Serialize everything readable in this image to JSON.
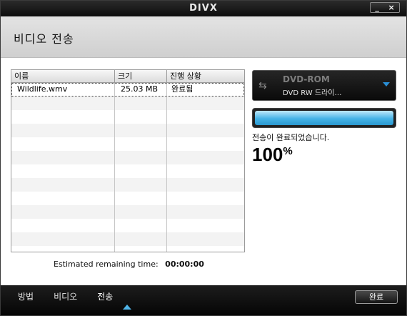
{
  "window": {
    "logo": "DIVX",
    "minimize": "_",
    "close": "×"
  },
  "header": {
    "title": "비디오 전송"
  },
  "file_table": {
    "columns": [
      "이름",
      "크기",
      "진행 상황"
    ],
    "rows": [
      {
        "name": "Wildlife.wmv",
        "size": "25.03 MB",
        "status": "완료됨"
      }
    ]
  },
  "remaining": {
    "label": "Estimated remaining time:",
    "value": "00:00:00"
  },
  "device": {
    "name": "DVD-ROM",
    "sub": "DVD RW 드라이…",
    "icon": "usb-icon"
  },
  "progress": {
    "fraction": 1.0,
    "status_text": "전송이 완료되었습니다.",
    "percent_value": "100",
    "percent_sign": "%"
  },
  "bottom_nav": {
    "items": [
      "방법",
      "비디오",
      "전송"
    ],
    "active": "전송"
  },
  "done_button": "완료",
  "colors": {
    "accent": "#45b3e6",
    "arrow": "#2a8fd6"
  }
}
